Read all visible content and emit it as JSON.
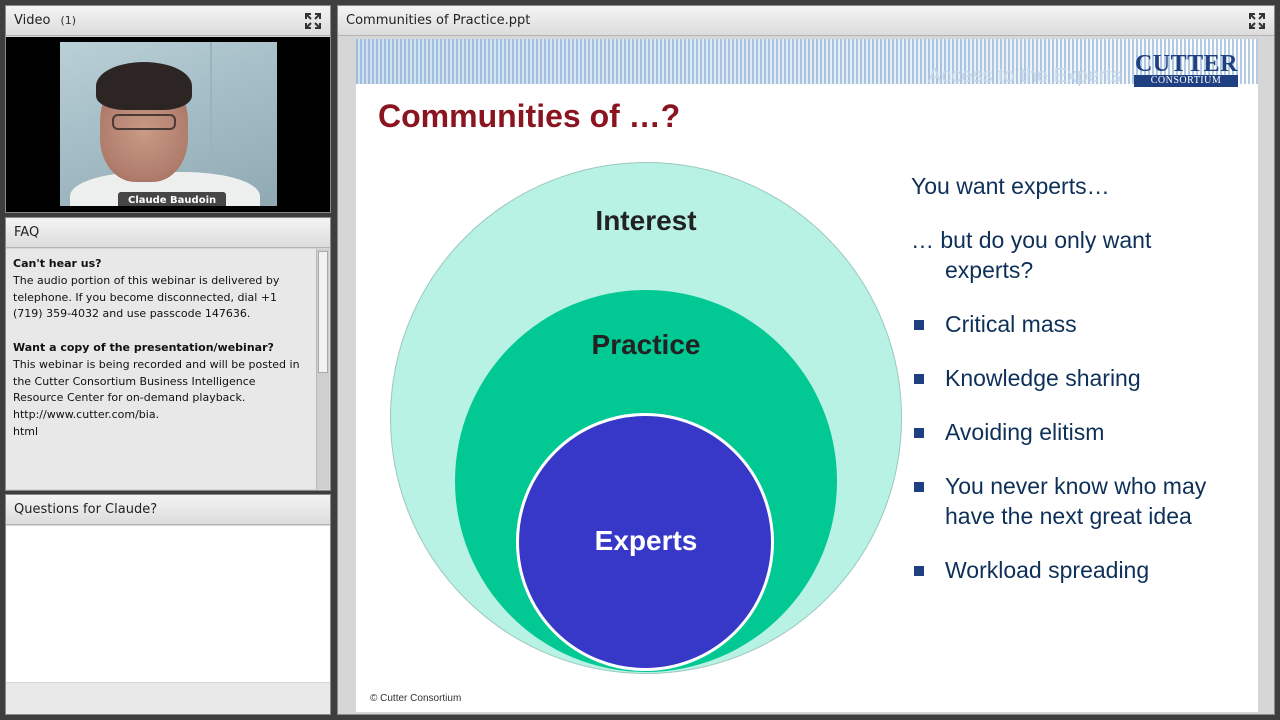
{
  "video_pod": {
    "title": "Video",
    "count": "(1)",
    "name_tag": "Claude Baudoin"
  },
  "faq_pod": {
    "title": "FAQ",
    "q1_heading": "Can't hear us?",
    "q1_body": "The audio portion of this webinar is delivered by telephone.  If you become disconnected, dial +1 (719) 359-4032 and use passcode 147636.",
    "q2_heading": "Want a copy of the presentation/webinar?",
    "q2_body_1": "This webinar is being recorded and will be posted in the Cutter Consortium Business Intelligence Resource Center for on-demand playback.",
    "q2_body_2": "http://www.cutter.com/bia.",
    "q2_body_3": "html"
  },
  "questions_pod": {
    "title": "Questions for Claude?"
  },
  "slide_pod": {
    "title": "Communities of Practice.ppt",
    "slide": {
      "tagline": "Access to the Experts",
      "logo_line1": "CUTTER",
      "logo_line2": "CONSORTIUM",
      "heading": "Communities of …?",
      "circle_outer": "Interest",
      "circle_mid": "Practice",
      "circle_inner": "Experts",
      "lead_1": "You want experts…",
      "lead_2a": "… but do you only want",
      "lead_2b": "experts?",
      "bullets": [
        "Critical mass",
        "Knowledge sharing",
        "Avoiding elitism",
        "You never know who may",
        "have the next great idea",
        "Workload spreading"
      ],
      "copyright": "© Cutter Consortium"
    }
  },
  "colors": {
    "title_red": "#8a1520",
    "outer_circle": "#b8f2e5",
    "middle_circle": "#02c994",
    "inner_circle": "#3838c8",
    "text_navy": "#0e3058"
  }
}
